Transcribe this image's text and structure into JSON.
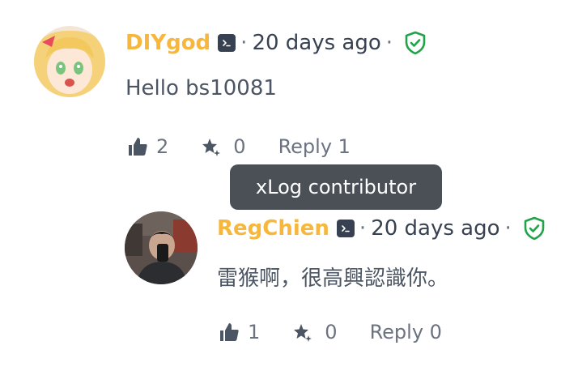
{
  "comments": [
    {
      "author": "DIYgod",
      "time": "20 days ago",
      "content": "Hello bs10081",
      "likes": "2",
      "tips": "0",
      "reply_label": "Reply 1"
    },
    {
      "author": "RegChien",
      "time": "20 days ago",
      "content": "雷猴啊，很高興認識你。",
      "likes": "1",
      "tips": "0",
      "reply_label": "Reply 0"
    }
  ],
  "tooltip": {
    "text": "xLog contributor"
  },
  "separator": "·",
  "colors": {
    "author": "#f6b73c",
    "verified": "#22a34a",
    "tooltip_bg": "#4b5057",
    "text": "#374151"
  },
  "icons": {
    "terminal": "terminal-icon",
    "verified": "shield-check-icon",
    "like": "thumbs-up-icon",
    "tip": "star-sparkle-icon"
  }
}
